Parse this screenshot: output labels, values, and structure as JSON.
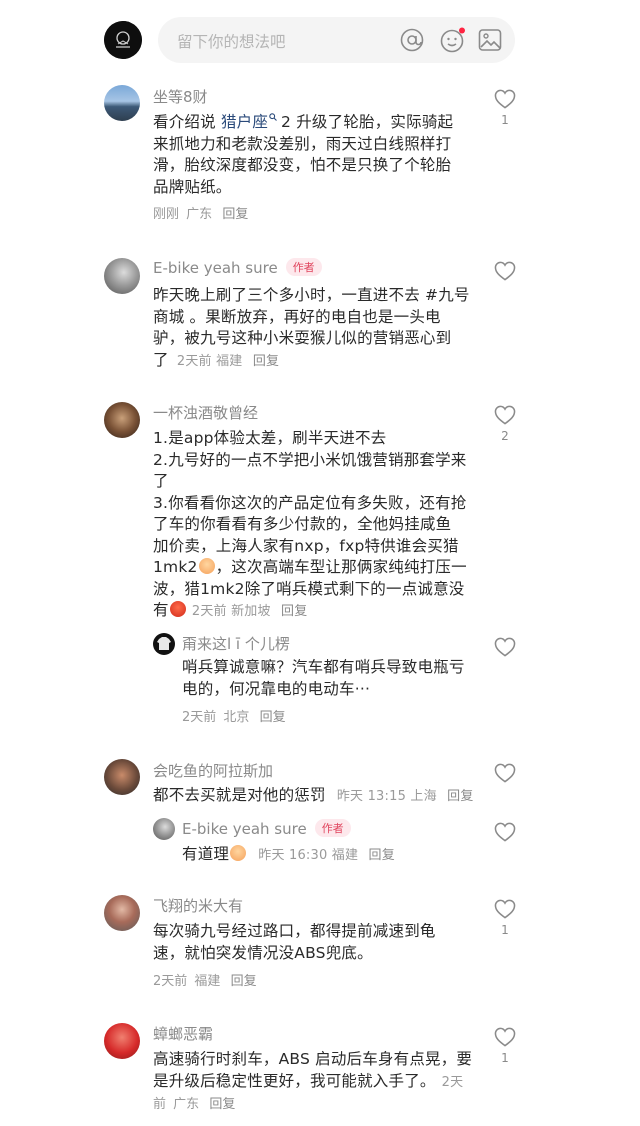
{
  "input_bar": {
    "placeholder": "留下你的想法吧",
    "icons": [
      "at-icon",
      "emoji-icon",
      "image-icon"
    ]
  },
  "comments": [
    {
      "user": "坐等8财",
      "content_pre": "看介绍说 ",
      "link": "猎户座",
      "content_lines": [
        "2 升级了轮胎，实际骑起",
        "来抓地力和老款没差别，雨天过白线照样打",
        "滑，胎纹深度都没变，怕不是只换了个轮胎",
        "品牌贴纸。"
      ],
      "time": "刚刚",
      "location": "广东",
      "reply": "回复",
      "likes": "1"
    },
    {
      "user": "E-bike yeah sure",
      "tag": "作者",
      "lines": [
        "昨天晚上刷了三个多小时，一直进不去 #九号",
        "商城 。果断放弃，再好的电自也是一头电",
        "驴，被九号这种小米耍猴儿似的营销恶心到",
        "了"
      ],
      "time": "2天前",
      "location": "福建",
      "reply": "回复",
      "likes": ""
    },
    {
      "user": "一杯浊酒敬曾经",
      "lines": [
        "1.是app体验太差，刷半天进不去",
        "2.九号好的一点不学把小米饥饿营销那套学来",
        "了",
        "3.你看看你这次的产品定位有多失败，还有抢",
        "了车的你看看有多少付款的，全他妈挂咸鱼",
        "加价卖，上海人家有nxp，fxp特供谁会买猎",
        "1mk2",
        "，这次高端车型让那俩家纯纯打压一",
        "波，猎1mk2除了哨兵模式剩下的一点诚意没",
        "有"
      ],
      "time": "2天前",
      "location": "新加坡",
      "reply": "回复",
      "likes": "2",
      "sub_reply": {
        "user": "甭来这l ī 个儿楞",
        "lines": [
          "哨兵算诚意嘛？汽车都有哨兵导致电瓶亏",
          "电的，何况靠电的电动车···"
        ],
        "time": "2天前",
        "location": "北京",
        "reply": "回复"
      }
    },
    {
      "user": "会吃鱼的阿拉斯加",
      "line": "都不去买就是对他的惩罚",
      "time": "昨天 13:15",
      "location": "上海",
      "reply": "回复",
      "likes": "",
      "sub_reply": {
        "user": "E-bike yeah sure",
        "tag": "作者",
        "line": "有道理",
        "time": "昨天 16:30",
        "location": "福建",
        "reply": "回复"
      }
    },
    {
      "user": "飞翔的米大有",
      "lines": [
        "每次骑九号经过路口，都得提前减速到龟",
        "速，就怕突发情况没ABS兜底。"
      ],
      "time": "2天前",
      "location": "福建",
      "reply": "回复",
      "likes": "1"
    },
    {
      "user": "蟑螂恶霸",
      "lines": [
        "高速骑行时刹车，ABS 启动后车身有点晃，要",
        "是升级后稳定性更好，我可能就入手了。"
      ],
      "time": "2天",
      "time2": "前",
      "location": "广东",
      "reply": "回复",
      "likes": "1"
    }
  ],
  "colors": {
    "accent_tag": "#e0455e",
    "notification_dot": "#ff2442",
    "link": "#2a4a7a"
  }
}
